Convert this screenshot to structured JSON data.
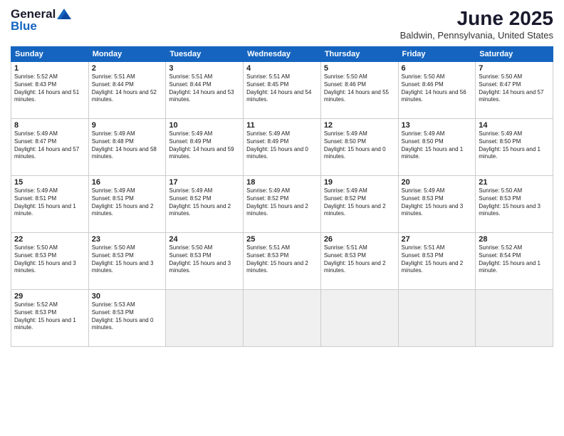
{
  "header": {
    "logo_general": "General",
    "logo_blue": "Blue",
    "month_title": "June 2025",
    "location": "Baldwin, Pennsylvania, United States"
  },
  "weekdays": [
    "Sunday",
    "Monday",
    "Tuesday",
    "Wednesday",
    "Thursday",
    "Friday",
    "Saturday"
  ],
  "weeks": [
    [
      {
        "num": "1",
        "sunrise": "Sunrise: 5:52 AM",
        "sunset": "Sunset: 8:43 PM",
        "daylight": "Daylight: 14 hours and 51 minutes."
      },
      {
        "num": "2",
        "sunrise": "Sunrise: 5:51 AM",
        "sunset": "Sunset: 8:44 PM",
        "daylight": "Daylight: 14 hours and 52 minutes."
      },
      {
        "num": "3",
        "sunrise": "Sunrise: 5:51 AM",
        "sunset": "Sunset: 8:44 PM",
        "daylight": "Daylight: 14 hours and 53 minutes."
      },
      {
        "num": "4",
        "sunrise": "Sunrise: 5:51 AM",
        "sunset": "Sunset: 8:45 PM",
        "daylight": "Daylight: 14 hours and 54 minutes."
      },
      {
        "num": "5",
        "sunrise": "Sunrise: 5:50 AM",
        "sunset": "Sunset: 8:46 PM",
        "daylight": "Daylight: 14 hours and 55 minutes."
      },
      {
        "num": "6",
        "sunrise": "Sunrise: 5:50 AM",
        "sunset": "Sunset: 8:46 PM",
        "daylight": "Daylight: 14 hours and 56 minutes."
      },
      {
        "num": "7",
        "sunrise": "Sunrise: 5:50 AM",
        "sunset": "Sunset: 8:47 PM",
        "daylight": "Daylight: 14 hours and 57 minutes."
      }
    ],
    [
      {
        "num": "8",
        "sunrise": "Sunrise: 5:49 AM",
        "sunset": "Sunset: 8:47 PM",
        "daylight": "Daylight: 14 hours and 57 minutes."
      },
      {
        "num": "9",
        "sunrise": "Sunrise: 5:49 AM",
        "sunset": "Sunset: 8:48 PM",
        "daylight": "Daylight: 14 hours and 58 minutes."
      },
      {
        "num": "10",
        "sunrise": "Sunrise: 5:49 AM",
        "sunset": "Sunset: 8:49 PM",
        "daylight": "Daylight: 14 hours and 59 minutes."
      },
      {
        "num": "11",
        "sunrise": "Sunrise: 5:49 AM",
        "sunset": "Sunset: 8:49 PM",
        "daylight": "Daylight: 15 hours and 0 minutes."
      },
      {
        "num": "12",
        "sunrise": "Sunrise: 5:49 AM",
        "sunset": "Sunset: 8:50 PM",
        "daylight": "Daylight: 15 hours and 0 minutes."
      },
      {
        "num": "13",
        "sunrise": "Sunrise: 5:49 AM",
        "sunset": "Sunset: 8:50 PM",
        "daylight": "Daylight: 15 hours and 1 minute."
      },
      {
        "num": "14",
        "sunrise": "Sunrise: 5:49 AM",
        "sunset": "Sunset: 8:50 PM",
        "daylight": "Daylight: 15 hours and 1 minute."
      }
    ],
    [
      {
        "num": "15",
        "sunrise": "Sunrise: 5:49 AM",
        "sunset": "Sunset: 8:51 PM",
        "daylight": "Daylight: 15 hours and 1 minute."
      },
      {
        "num": "16",
        "sunrise": "Sunrise: 5:49 AM",
        "sunset": "Sunset: 8:51 PM",
        "daylight": "Daylight: 15 hours and 2 minutes."
      },
      {
        "num": "17",
        "sunrise": "Sunrise: 5:49 AM",
        "sunset": "Sunset: 8:52 PM",
        "daylight": "Daylight: 15 hours and 2 minutes."
      },
      {
        "num": "18",
        "sunrise": "Sunrise: 5:49 AM",
        "sunset": "Sunset: 8:52 PM",
        "daylight": "Daylight: 15 hours and 2 minutes."
      },
      {
        "num": "19",
        "sunrise": "Sunrise: 5:49 AM",
        "sunset": "Sunset: 8:52 PM",
        "daylight": "Daylight: 15 hours and 2 minutes."
      },
      {
        "num": "20",
        "sunrise": "Sunrise: 5:49 AM",
        "sunset": "Sunset: 8:53 PM",
        "daylight": "Daylight: 15 hours and 3 minutes."
      },
      {
        "num": "21",
        "sunrise": "Sunrise: 5:50 AM",
        "sunset": "Sunset: 8:53 PM",
        "daylight": "Daylight: 15 hours and 3 minutes."
      }
    ],
    [
      {
        "num": "22",
        "sunrise": "Sunrise: 5:50 AM",
        "sunset": "Sunset: 8:53 PM",
        "daylight": "Daylight: 15 hours and 3 minutes."
      },
      {
        "num": "23",
        "sunrise": "Sunrise: 5:50 AM",
        "sunset": "Sunset: 8:53 PM",
        "daylight": "Daylight: 15 hours and 3 minutes."
      },
      {
        "num": "24",
        "sunrise": "Sunrise: 5:50 AM",
        "sunset": "Sunset: 8:53 PM",
        "daylight": "Daylight: 15 hours and 3 minutes."
      },
      {
        "num": "25",
        "sunrise": "Sunrise: 5:51 AM",
        "sunset": "Sunset: 8:53 PM",
        "daylight": "Daylight: 15 hours and 2 minutes."
      },
      {
        "num": "26",
        "sunrise": "Sunrise: 5:51 AM",
        "sunset": "Sunset: 8:53 PM",
        "daylight": "Daylight: 15 hours and 2 minutes."
      },
      {
        "num": "27",
        "sunrise": "Sunrise: 5:51 AM",
        "sunset": "Sunset: 8:53 PM",
        "daylight": "Daylight: 15 hours and 2 minutes."
      },
      {
        "num": "28",
        "sunrise": "Sunrise: 5:52 AM",
        "sunset": "Sunset: 8:54 PM",
        "daylight": "Daylight: 15 hours and 1 minute."
      }
    ],
    [
      {
        "num": "29",
        "sunrise": "Sunrise: 5:52 AM",
        "sunset": "Sunset: 8:53 PM",
        "daylight": "Daylight: 15 hours and 1 minute."
      },
      {
        "num": "30",
        "sunrise": "Sunrise: 5:53 AM",
        "sunset": "Sunset: 8:53 PM",
        "daylight": "Daylight: 15 hours and 0 minutes."
      },
      null,
      null,
      null,
      null,
      null
    ]
  ]
}
